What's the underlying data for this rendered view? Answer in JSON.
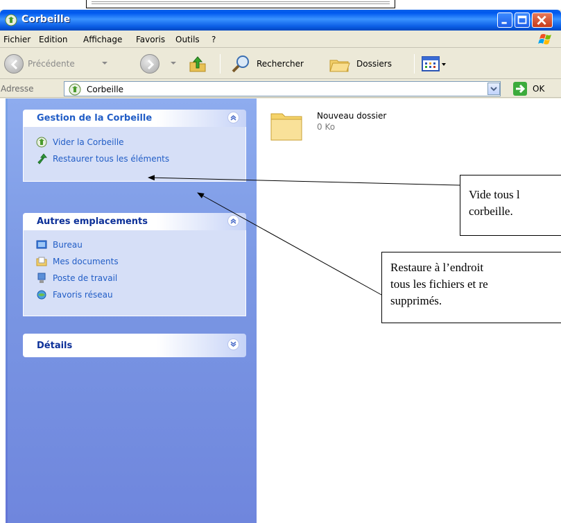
{
  "window": {
    "title": "Corbeille"
  },
  "menu": {
    "items": [
      {
        "label": "Fichier"
      },
      {
        "label": "Edition"
      },
      {
        "label": "Affichage"
      },
      {
        "label": "Favoris"
      },
      {
        "label": "Outils"
      },
      {
        "label": "?"
      }
    ]
  },
  "toolbar": {
    "back_label": "Précédente",
    "search_label": "Rechercher",
    "folders_label": "Dossiers"
  },
  "address": {
    "label": "Adresse",
    "value": "Corbeille",
    "go_label": "OK"
  },
  "sidebar": {
    "panels": [
      {
        "title": "Gestion de la Corbeille",
        "tasks": [
          {
            "label": "Vider la Corbeille",
            "icon": "recycle-bin-icon"
          },
          {
            "label": "Restaurer tous les éléments",
            "icon": "restore-arrow-icon"
          }
        ]
      },
      {
        "title": "Autres emplacements",
        "tasks": [
          {
            "label": "Bureau",
            "icon": "desktop-icon"
          },
          {
            "label": "Mes documents",
            "icon": "documents-folder-icon"
          },
          {
            "label": "Poste de travail",
            "icon": "computer-icon"
          },
          {
            "label": "Favoris réseau",
            "icon": "network-icon"
          }
        ]
      },
      {
        "title": "Détails",
        "tasks": []
      }
    ]
  },
  "files": [
    {
      "name": "Nouveau dossier",
      "size": "0 Ko",
      "icon": "folder-icon"
    }
  ],
  "annotations": [
    {
      "text_lines": [
        "Vide tous l",
        "corbeille."
      ]
    },
    {
      "text_lines": [
        "Restaure à l’endroit",
        "tous les fichiers et re",
        "supprimés."
      ]
    }
  ],
  "colors": {
    "titlebar": "#0058ee",
    "task_link": "#215dc6",
    "sidebar_bg": "#7b98e4",
    "panel_body": "#d6dff7"
  }
}
